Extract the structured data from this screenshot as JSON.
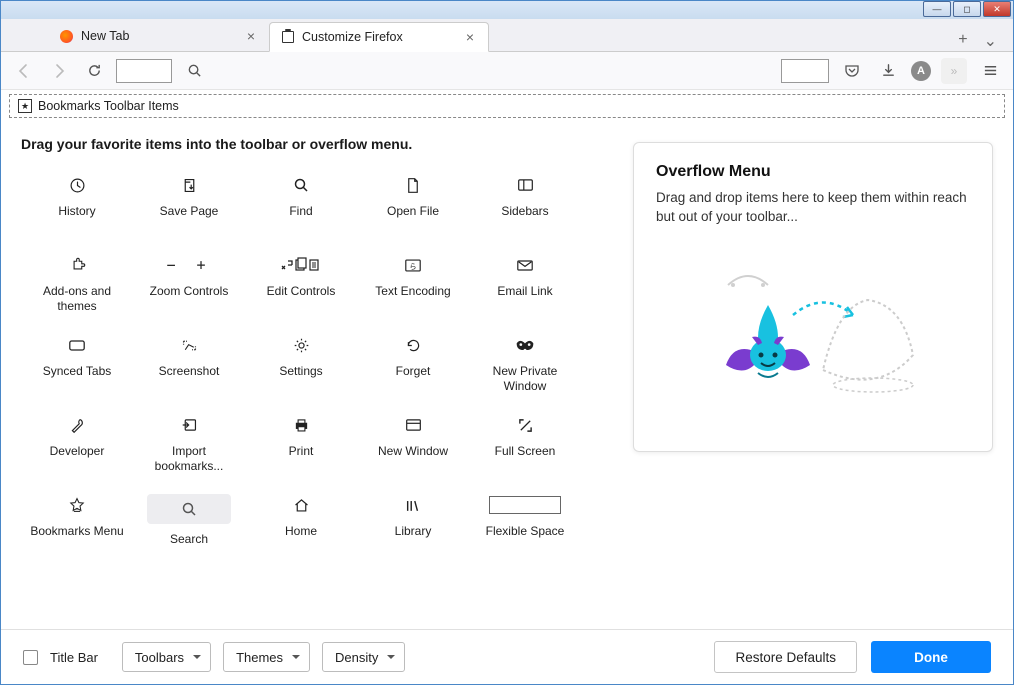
{
  "window_controls": {
    "min": "—",
    "max": "◻",
    "close": "✕"
  },
  "tabs": [
    {
      "label": "New Tab"
    },
    {
      "label": "Customize Firefox"
    }
  ],
  "tab_actions": {
    "newtab": "+",
    "alltabs": "⌄"
  },
  "toolbar": {
    "account_initial": "A"
  },
  "bookmarks_toolbar": {
    "label": "Bookmarks Toolbar Items"
  },
  "instruction": "Drag your favorite items into the toolbar or overflow menu.",
  "items": [
    {
      "label": "History"
    },
    {
      "label": "Save Page"
    },
    {
      "label": "Find"
    },
    {
      "label": "Open File"
    },
    {
      "label": "Sidebars"
    },
    {
      "label": "Add-ons and themes"
    },
    {
      "label": "Zoom Controls"
    },
    {
      "label": "Edit Controls"
    },
    {
      "label": "Text Encoding"
    },
    {
      "label": "Email Link"
    },
    {
      "label": "Synced Tabs"
    },
    {
      "label": "Screenshot"
    },
    {
      "label": "Settings"
    },
    {
      "label": "Forget"
    },
    {
      "label": "New Private Window"
    },
    {
      "label": "Developer"
    },
    {
      "label": "Import bookmarks..."
    },
    {
      "label": "Print"
    },
    {
      "label": "New Window"
    },
    {
      "label": "Full Screen"
    },
    {
      "label": "Bookmarks Menu"
    },
    {
      "label": "Search"
    },
    {
      "label": "Home"
    },
    {
      "label": "Library"
    },
    {
      "label": "Flexible Space"
    }
  ],
  "overflow": {
    "title": "Overflow Menu",
    "desc": "Drag and drop items here to keep them within reach but out of your toolbar..."
  },
  "footer": {
    "titlebar_label": "Title Bar",
    "dd_toolbars": "Toolbars",
    "dd_themes": "Themes",
    "dd_density": "Density",
    "restore": "Restore Defaults",
    "done": "Done"
  }
}
